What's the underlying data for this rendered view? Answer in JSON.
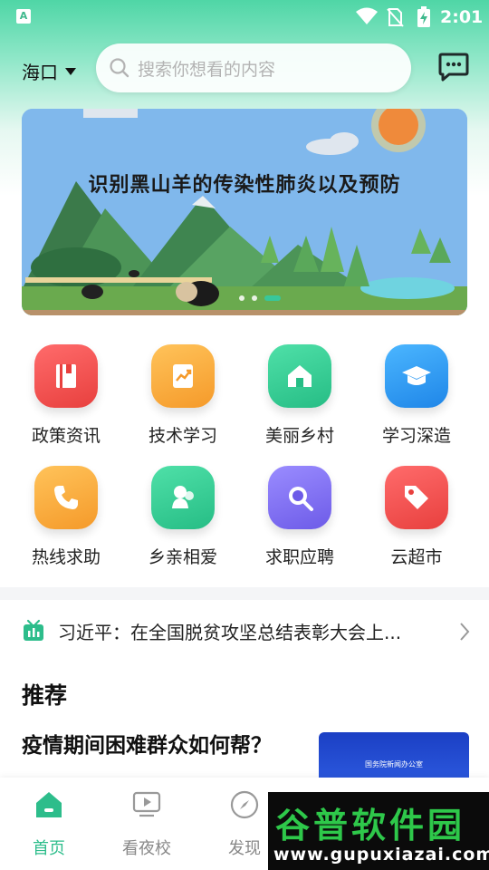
{
  "status_bar": {
    "time": "2:01",
    "app_badge": "A"
  },
  "header": {
    "city": "海口",
    "search_placeholder": "搜索你想看的内容"
  },
  "banner": {
    "title": "识别黑山羊的传染性肺炎以及预防",
    "page_count": 3,
    "active_page": 3
  },
  "services": [
    {
      "label": "政策资讯",
      "icon": "book-icon",
      "color": "#f0514f"
    },
    {
      "label": "技术学习",
      "icon": "chart-book-icon",
      "color": "#f9a83a"
    },
    {
      "label": "美丽乡村",
      "icon": "house-icon",
      "color": "#33cc93"
    },
    {
      "label": "学习深造",
      "icon": "graduation-cap-icon",
      "color": "#2f9cf0"
    },
    {
      "label": "热线求助",
      "icon": "phone-icon",
      "color": "#f9a83a"
    },
    {
      "label": "乡亲相爱",
      "icon": "people-icon",
      "color": "#33cc93"
    },
    {
      "label": "求职应聘",
      "icon": "search-magnifier-icon",
      "color": "#7b6cf0"
    },
    {
      "label": "云超市",
      "icon": "price-tag-icon",
      "color": "#f0514f"
    }
  ],
  "news_ticker": {
    "icon": "tv-icon",
    "text": "习近平：在全国脱贫攻坚总结表彰大会上..."
  },
  "recommend": {
    "title": "推荐",
    "article_title": "疫情期间困难群众如何帮？",
    "thumb_caption": "国务院新闻办公室"
  },
  "tabs": [
    {
      "label": "首页",
      "icon": "home-icon",
      "active": true
    },
    {
      "label": "看夜校",
      "icon": "play-screen-icon",
      "active": false
    },
    {
      "label": "发现",
      "icon": "compass-icon",
      "active": false
    }
  ],
  "watermark": {
    "brand": "谷普软件园",
    "url": "www.gupuxiazai.com"
  },
  "colors": {
    "accent": "#2dbd8b",
    "header_gradient_top": "#4fd6a6"
  }
}
